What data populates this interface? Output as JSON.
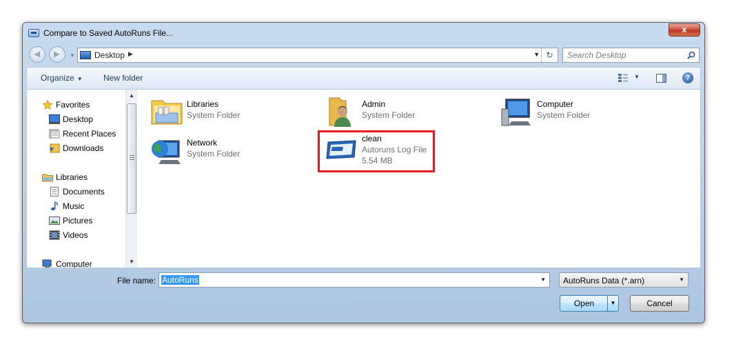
{
  "window": {
    "title": "Compare to Saved AutoRuns File...",
    "close_label": "x"
  },
  "address": {
    "location": "Desktop",
    "search_placeholder": "Search Desktop"
  },
  "toolbar": {
    "organize_label": "Organize",
    "new_folder_label": "New folder"
  },
  "sidebar": {
    "items": [
      {
        "label": "Favorites",
        "icon": "star-icon"
      },
      {
        "label": "Desktop",
        "icon": "desktop-icon"
      },
      {
        "label": "Recent Places",
        "icon": "recent-places-icon"
      },
      {
        "label": "Downloads",
        "icon": "downloads-icon"
      },
      {
        "label": "Libraries",
        "icon": "libraries-icon"
      },
      {
        "label": "Documents",
        "icon": "documents-icon"
      },
      {
        "label": "Music",
        "icon": "music-icon"
      },
      {
        "label": "Pictures",
        "icon": "pictures-icon"
      },
      {
        "label": "Videos",
        "icon": "videos-icon"
      },
      {
        "label": "Computer",
        "icon": "computer-icon"
      }
    ]
  },
  "files": [
    {
      "name": "Libraries",
      "type": "System Folder",
      "icon": "libraries-folder-icon"
    },
    {
      "name": "Admin",
      "type": "System Folder",
      "icon": "user-folder-icon"
    },
    {
      "name": "Computer",
      "type": "System Folder",
      "icon": "computer-icon"
    },
    {
      "name": "Network",
      "type": "System Folder",
      "icon": "network-icon"
    },
    {
      "name": "clean",
      "type": "Autoruns Log File",
      "size": "5.54 MB",
      "icon": "autoruns-file-icon"
    }
  ],
  "footer": {
    "file_name_label": "File name:",
    "file_name_value": "AutoRuns",
    "file_type_value": "AutoRuns Data (*.arn)",
    "open_label": "Open",
    "cancel_label": "Cancel"
  },
  "colors": {
    "highlight": "#e11b22",
    "selection": "#3399ff",
    "accent": "#1e395b"
  }
}
